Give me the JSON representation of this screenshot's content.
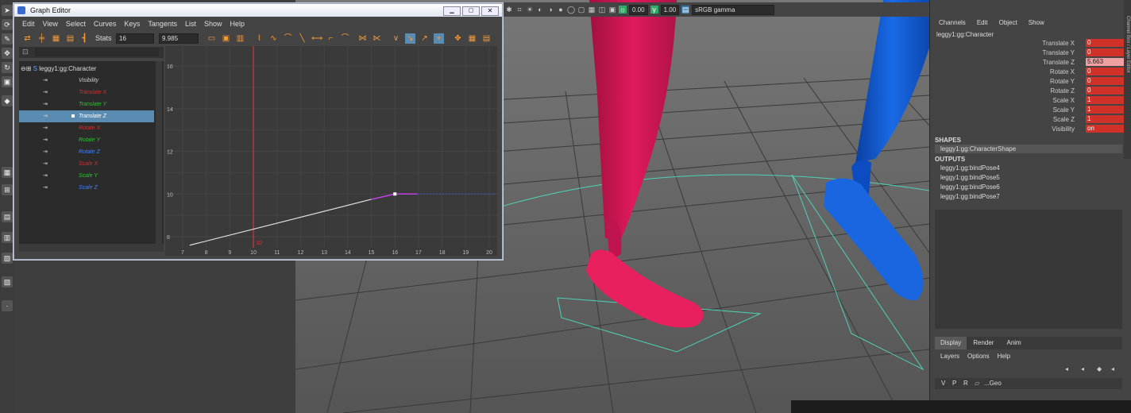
{
  "graph_editor": {
    "title": "Graph Editor",
    "menu": [
      "Edit",
      "View",
      "Select",
      "Curves",
      "Keys",
      "Tangents",
      "List",
      "Show",
      "Help"
    ],
    "stats_label": "Stats",
    "stats_frame": "16",
    "stats_value": "9.985",
    "outliner": {
      "root": "leggy1:gg:Character",
      "channels": [
        {
          "label": "Visibility",
          "color": "#cccccc",
          "selected": false
        },
        {
          "label": "Translate X",
          "color": "#d03030",
          "selected": false
        },
        {
          "label": "Translate Y",
          "color": "#30c030",
          "selected": false
        },
        {
          "label": "Translate Z",
          "color": "#ffffff",
          "selected": true
        },
        {
          "label": "Rotate X",
          "color": "#d03030",
          "selected": false
        },
        {
          "label": "Rotate Y",
          "color": "#30c030",
          "selected": false
        },
        {
          "label": "Rotate Z",
          "color": "#4080ff",
          "selected": false
        },
        {
          "label": "Scale X",
          "color": "#d03030",
          "selected": false
        },
        {
          "label": "Scale Y",
          "color": "#30c030",
          "selected": false
        },
        {
          "label": "Scale Z",
          "color": "#4080ff",
          "selected": false
        }
      ]
    },
    "graph": {
      "y_ticks": [
        "16",
        "14",
        "12",
        "10",
        "8"
      ],
      "x_ticks": [
        "7",
        "8",
        "9",
        "10",
        "11",
        "12",
        "13",
        "14",
        "15",
        "16",
        "17",
        "18",
        "19",
        "20"
      ],
      "current_frame": "10",
      "current_frame_label": "10",
      "keys": [
        {
          "frame": 8,
          "value": 7.8
        },
        {
          "frame": 16,
          "value": 10
        }
      ]
    }
  },
  "viewport_toolbar": {
    "val1": "0.00",
    "val2": "1.00",
    "colorspace": "sRGB gamma"
  },
  "channel_box": {
    "menu": [
      "Channels",
      "Edit",
      "Object",
      "Show"
    ],
    "object": "leggy1:gg:Character",
    "attrs": [
      {
        "name": "Translate X",
        "value": "0",
        "highlight": false
      },
      {
        "name": "Translate Y",
        "value": "0",
        "highlight": false
      },
      {
        "name": "Translate Z",
        "value": "5.663",
        "highlight": true
      },
      {
        "name": "Rotate X",
        "value": "0",
        "highlight": false
      },
      {
        "name": "Rotate Y",
        "value": "0",
        "highlight": false
      },
      {
        "name": "Rotate Z",
        "value": "0",
        "highlight": false
      },
      {
        "name": "Scale X",
        "value": "1",
        "highlight": false
      },
      {
        "name": "Scale Y",
        "value": "1",
        "highlight": false
      },
      {
        "name": "Scale Z",
        "value": "1",
        "highlight": false
      },
      {
        "name": "Visibility",
        "value": "on",
        "highlight": false
      }
    ],
    "shapes_header": "SHAPES",
    "shape": "leggy1:gg:CharacterShape",
    "outputs_header": "OUTPUTS",
    "outputs": [
      "leggy1:gg:bindPose4",
      "leggy1:gg:bindPose5",
      "leggy1:gg:bindPose6",
      "leggy1:gg:bindPose7"
    ],
    "side_tab": "Channel Box / Layer Editor"
  },
  "layer_editor": {
    "tabs": [
      "Display",
      "Render",
      "Anim"
    ],
    "menu": [
      "Layers",
      "Options",
      "Help"
    ],
    "layer": {
      "v": "V",
      "p": "P",
      "r": "R",
      "name": "...Geo"
    }
  },
  "colors": {
    "accent": "#f29a3a",
    "selection": "#5a8bb0",
    "keyed": "#d0322a",
    "curve": "#e0e0e0",
    "red_foot": "#e0195a",
    "blue_foot": "#1a66e0"
  }
}
